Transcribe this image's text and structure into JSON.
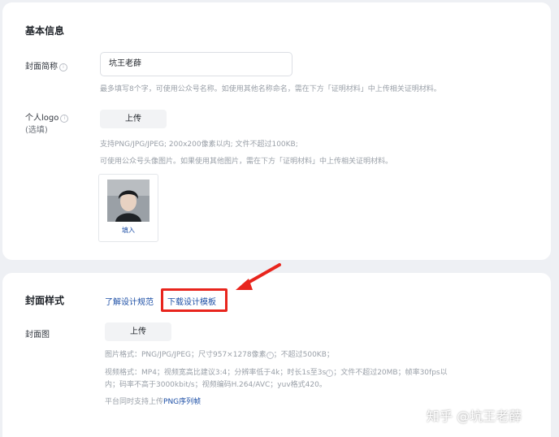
{
  "basic_info": {
    "title": "基本信息",
    "cover_short_name": {
      "label": "封面简称",
      "value": "坑王老薛",
      "hint": "最多填写8个字，可使用公众号名称。如使用其他名称命名，需在下方「证明材料」中上传相关证明材料。"
    },
    "logo": {
      "label": "个人logo",
      "optional": "(选填)",
      "upload_label": "上传",
      "hint_line1": "支持PNG/JPG/JPEG; 200x200像素以内; 文件不超过100KB;",
      "hint_line2": "可使用公众号头像图片。如果使用其他图片，需在下方「证明材料」中上传相关证明材料。",
      "fill_label": "填入"
    }
  },
  "cover_style": {
    "title": "封面样式",
    "design_spec_link": "了解设计规范",
    "download_template_link": "下载设计模板",
    "cover_image": {
      "label": "封面图",
      "upload_label": "上传",
      "image_format_prefix": "图片格式：PNG/JPG/JPEG；尺寸957×1278像素",
      "image_format_suffix": "；不超过500KB；",
      "video_format_line1_a": "视频格式：MP4；视频宽高比建议3:4；分辨率低于4k；时长1s至3s",
      "video_format_line1_b": "；文件不超过20MB；帧率30fps以",
      "video_format_line2": "内；码率不高于3000kbit/s；视频编码H.264/AVC；yuv格式420。",
      "png_sequence_prefix": "平台同时支持上传",
      "png_sequence_link": "PNG序列帧"
    }
  },
  "watermark": "知乎 @坑王老薛",
  "colors": {
    "accent_link": "#1d4fa6",
    "highlight_red": "#e8251d",
    "page_bg": "#eef0f4"
  },
  "icons": {
    "info": "info-circle-icon",
    "annotation": "red-arrow-icon"
  }
}
